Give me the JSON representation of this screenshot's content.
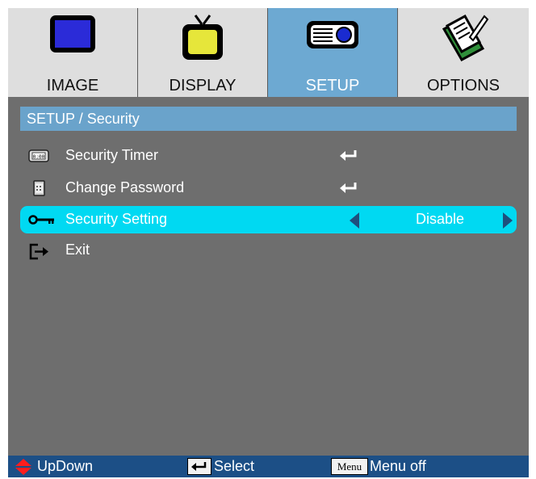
{
  "tabs": [
    {
      "label": "IMAGE",
      "icon": "monitor-icon",
      "active": false
    },
    {
      "label": "DISPLAY",
      "icon": "tv-icon",
      "active": false
    },
    {
      "label": "SETUP",
      "icon": "projector-icon",
      "active": true
    },
    {
      "label": "OPTIONS",
      "icon": "notepad-pencil-icon",
      "active": false
    }
  ],
  "header": {
    "title": "SETUP / Security"
  },
  "menu": {
    "items": [
      {
        "label": "Security Timer",
        "icon": "timer-icon",
        "action": "enter-icon"
      },
      {
        "label": "Change Password",
        "icon": "password-keypad-icon",
        "action": "enter-icon"
      },
      {
        "label": "Security Setting",
        "icon": "key-icon",
        "value": "Disable",
        "selected": true
      },
      {
        "label": "Exit",
        "icon": "exit-icon"
      }
    ]
  },
  "footer": {
    "updown_label": "UpDown",
    "select_label": "Select",
    "menu_key": "Menu",
    "menuoff_label": "Menu off"
  },
  "colors": {
    "active_tab": "#6da9d2",
    "highlight": "#00d9f2",
    "footer": "#1c4f86",
    "background": "#6e6e6e"
  }
}
